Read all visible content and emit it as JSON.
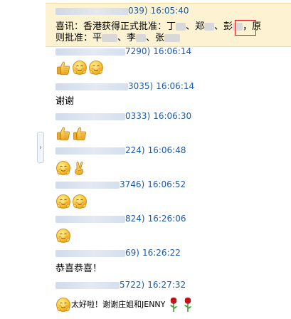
{
  "panel": {
    "collapse_glyph": "›"
  },
  "messages": [
    {
      "id_suffix": "039)",
      "time": "16:05:40",
      "highlighted": true,
      "line1_prefix": "喜讯：香港获得正式批准：丁",
      "line1_sep1": "、郑",
      "line1_sep2": "、",
      "line1_boxed": "彭",
      "line1_suffix": "，原",
      "line2_prefix": "则批准：平",
      "line2_sep1": "、李",
      "line2_sep2": "、张"
    },
    {
      "id_suffix": "7290)",
      "time": "16:06:14",
      "emojis": [
        "thumbs-up-icon",
        "blushing-face-icon",
        "blushing-face-icon"
      ]
    },
    {
      "id_suffix": "3035)",
      "time": "16:06:14",
      "text": "谢谢"
    },
    {
      "id_suffix": "0333)",
      "time": "16:06:30",
      "emojis": [
        "thumbs-up-icon",
        "thumbs-up-icon"
      ]
    },
    {
      "id_suffix": "224)",
      "time": "16:06:48",
      "emojis": [
        "blushing-face-icon",
        "victory-hand-icon"
      ]
    },
    {
      "id_suffix": "3746)",
      "time": "16:06:52",
      "emojis": [
        "blushing-face-icon",
        "blushing-face-icon"
      ]
    },
    {
      "id_suffix": "824)",
      "time": "16:26:06",
      "emojis": [
        "blushing-face-icon"
      ]
    },
    {
      "id_suffix": "69)",
      "time": "16:26:22",
      "text": "恭喜恭喜！"
    },
    {
      "id_suffix": "5722)",
      "time": "16:27:32",
      "text": "太好啦！谢谢庄姐和JENNY",
      "lead_emoji": "blushing-face-icon",
      "trail_emojis": [
        "rose-icon",
        "rose-icon"
      ]
    }
  ]
}
